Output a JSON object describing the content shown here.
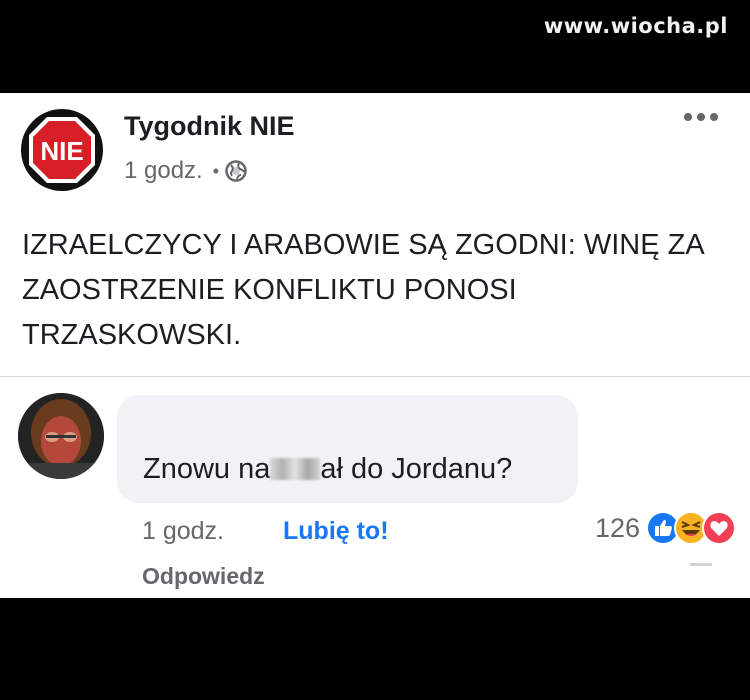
{
  "watermark": "www.wiocha.pl",
  "post": {
    "page_name": "Tygodnik NIE",
    "time": "1 godz.",
    "separator": "•",
    "privacy_icon": "globe-icon",
    "more_icon": "more-options-icon",
    "logo_text": "NIE",
    "text": "IZRAELCZYCY I ARABOWIE SĄ ZGODNI: WINĘ ZA ZAOSTRZENIE KONFLIKTU PONOSI TRZASKOWSKI."
  },
  "comment": {
    "text_before": "Znowu na",
    "text_after": "ał do Jordanu?",
    "time": "1 godz.",
    "like_label": "Lubię to!",
    "reply_label": "Odpowiedz",
    "reaction_count": "126",
    "reaction_icons": [
      "like-icon",
      "haha-icon",
      "love-icon"
    ]
  },
  "colors": {
    "background": "#000000",
    "card": "#ffffff",
    "accent": "#1877f2",
    "secondary_text": "#65676b",
    "logo_red": "#d61f26"
  }
}
